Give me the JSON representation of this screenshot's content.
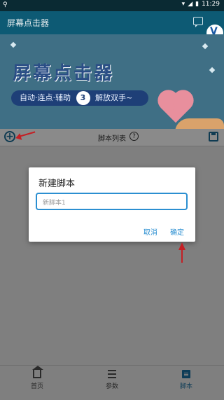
{
  "status_bar": {
    "carrier_icon": "vpn-key-icon",
    "time": "11:29"
  },
  "app": {
    "title": "屏幕点击器"
  },
  "banner": {
    "headline": "屏幕点击器",
    "tagline_before": "自动·连点·辅助",
    "tagline_num": "3",
    "tagline_after": "解放双手~"
  },
  "toolbar": {
    "label": "脚本列表",
    "help": "?"
  },
  "dialog": {
    "title": "新建脚本",
    "input_placeholder": "新脚本1",
    "cancel_label": "取消",
    "ok_label": "确定"
  },
  "nav": {
    "tabs": [
      {
        "label": "首页"
      },
      {
        "label": "参数"
      },
      {
        "label": "脚本"
      }
    ],
    "active": "脚本"
  },
  "colors": {
    "appbar": "#0d5a74",
    "accent": "#2b8fd1",
    "annotation_red": "#c41f24"
  }
}
